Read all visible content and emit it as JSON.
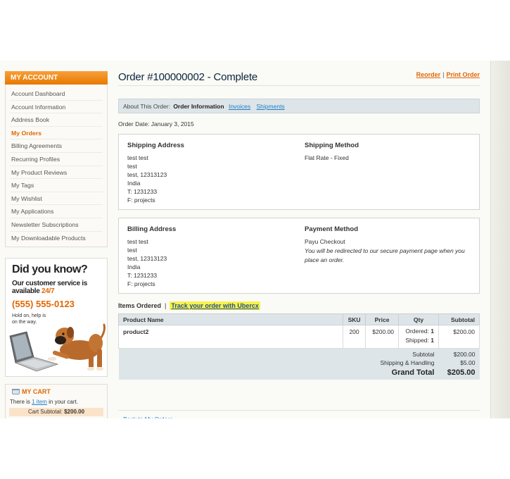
{
  "sidebar": {
    "title": "MY ACCOUNT",
    "items": [
      {
        "label": "Account Dashboard"
      },
      {
        "label": "Account Information"
      },
      {
        "label": "Address Book"
      },
      {
        "label": "My Orders"
      },
      {
        "label": "Billing Agreements"
      },
      {
        "label": "Recurring Profiles"
      },
      {
        "label": "My Product Reviews"
      },
      {
        "label": "My Tags"
      },
      {
        "label": "My Wishlist"
      },
      {
        "label": "My Applications"
      },
      {
        "label": "Newsletter Subscriptions"
      },
      {
        "label": "My Downloadable Products"
      }
    ],
    "current": "My Orders"
  },
  "did_you_know": {
    "title": "Did you know?",
    "line1": "Our customer service is",
    "line2_a": "available ",
    "line2_b": "24/7",
    "phone": "(555) 555-0123",
    "hold": "Hold on, help is on the way."
  },
  "cart": {
    "title": "MY CART",
    "text_a": "There is ",
    "link": "1 item",
    "text_b": " in your cart.",
    "subtotal_label": "Cart Subtotal: ",
    "subtotal_value": "$200.00"
  },
  "order": {
    "title": "Order #100000002 - Complete",
    "reorder": "Reorder",
    "print": "Print Order",
    "separator": "|",
    "tabs": {
      "label": "About This Order:",
      "current": "Order Information",
      "invoices": "Invoices",
      "shipments": "Shipments"
    },
    "date": "Order Date: January 3, 2015",
    "shipping_address": {
      "title": "Shipping Address",
      "lines": [
        "test test",
        "test",
        "test, 12313123",
        "India",
        "T: 1231233",
        "F: projects"
      ]
    },
    "shipping_method": {
      "title": "Shipping Method",
      "value": "Flat Rate - Fixed"
    },
    "billing_address": {
      "title": "Billing Address",
      "lines": [
        "test test",
        "test",
        "test, 12313123",
        "India",
        "T: 1231233",
        "F: projects"
      ]
    },
    "payment_method": {
      "title": "Payment Method",
      "value": "Payu Checkout",
      "note": "You will be redirected to our secure payment page when you place an order."
    },
    "items": {
      "title": "Items Ordered",
      "separator": "|",
      "track_link": "Track your order with Ubercx",
      "columns": [
        "Product Name",
        "SKU",
        "Price",
        "Qty",
        "Subtotal"
      ],
      "rows": [
        {
          "name": "product2",
          "sku": "200",
          "price": "$200.00",
          "ordered_label": "Ordered: ",
          "ordered": "1",
          "shipped_label": "Shipped: ",
          "shipped": "1",
          "subtotal": "$200.00"
        }
      ],
      "totals": {
        "subtotal_label": "Subtotal",
        "subtotal": "$200.00",
        "shipping_label": "Shipping & Handling",
        "shipping": "$5.00",
        "grand_label": "Grand Total",
        "grand": "$205.00"
      }
    },
    "back_link": "« Back to My Orders"
  },
  "colors": {
    "accent": "#e26703",
    "link": "#1e7ec8",
    "header_band": "#dee5e8",
    "highlight": "#f8f24a"
  }
}
